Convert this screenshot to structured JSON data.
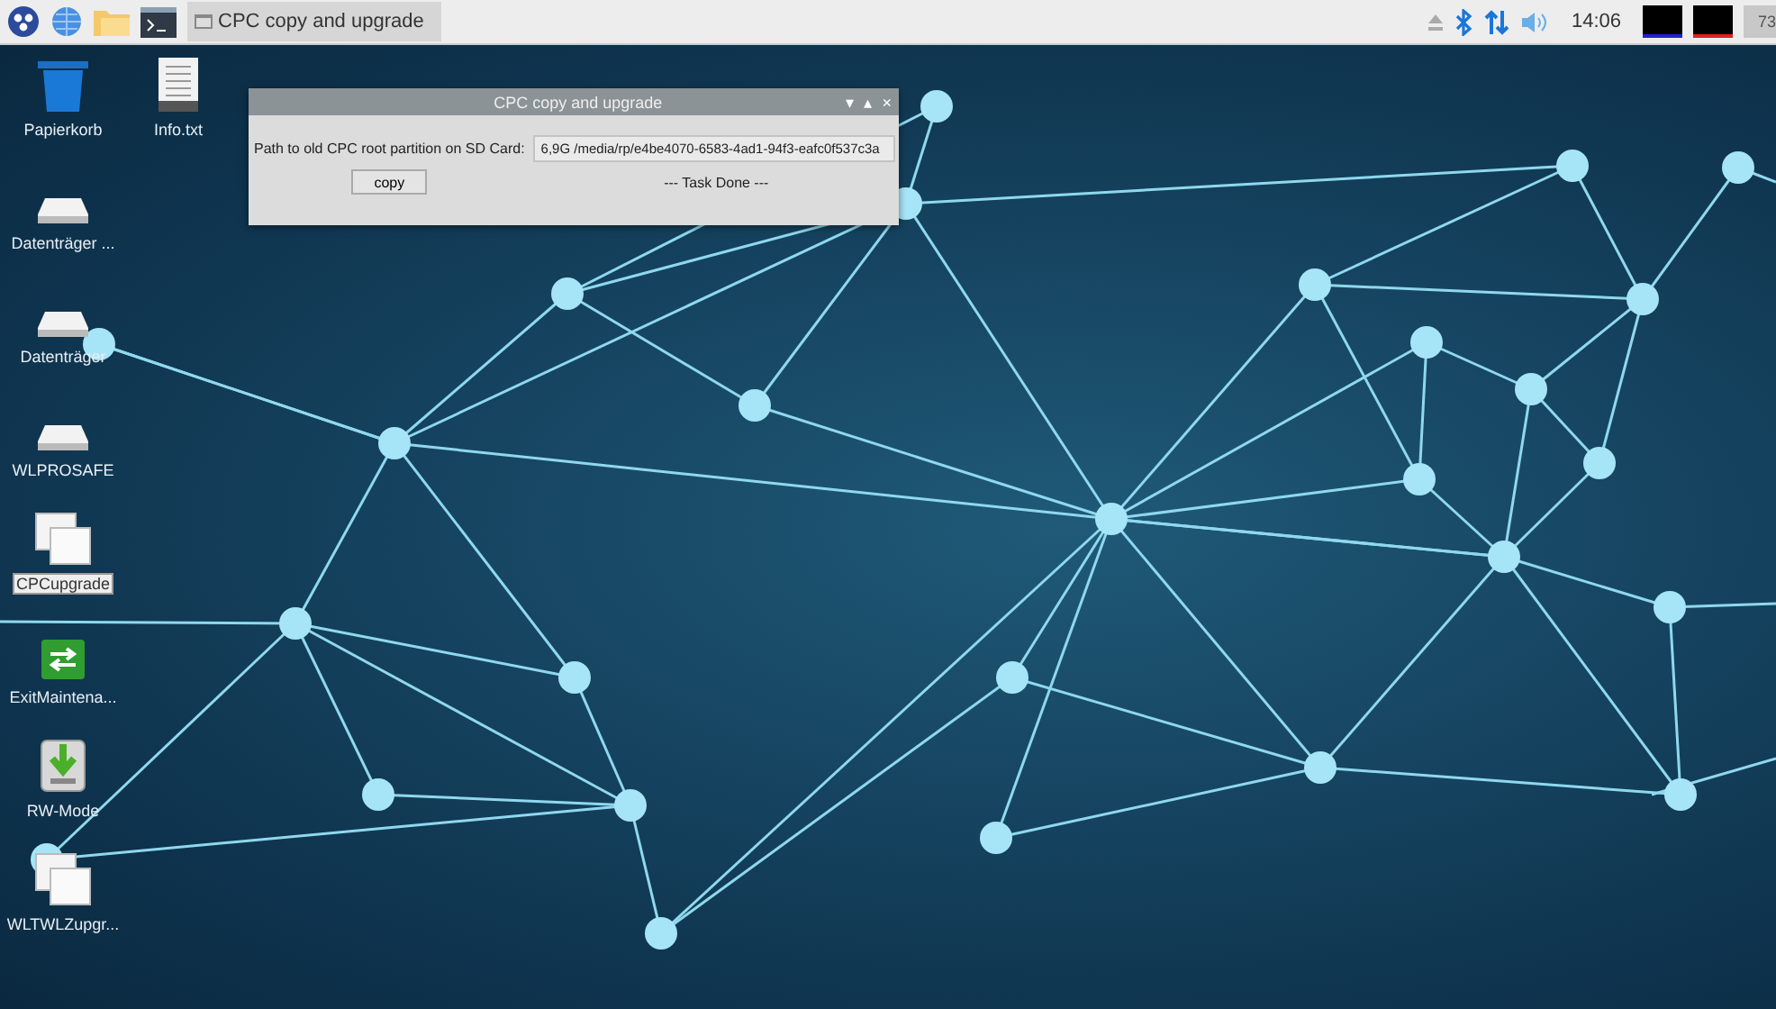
{
  "taskbar": {
    "task_button": {
      "label": "CPC copy and upgrade",
      "selected": true
    },
    "clock": "14:06",
    "cut_label": "73"
  },
  "desktop_icons": [
    {
      "label": "Papierkorb",
      "kind": "trash",
      "selected": false
    },
    {
      "label": "Datenträger ...",
      "kind": "drive",
      "selected": false
    },
    {
      "label": "Datenträger",
      "kind": "drive",
      "selected": false
    },
    {
      "label": "WLPROSAFE",
      "kind": "drive",
      "selected": false
    },
    {
      "label": "CPCupgrade",
      "kind": "window",
      "selected": true
    },
    {
      "label": "ExitMaintena...",
      "kind": "exchange",
      "selected": false
    },
    {
      "label": "RW-Mode",
      "kind": "install",
      "selected": false
    },
    {
      "label": "WLTWLZupgr...",
      "kind": "window",
      "selected": false
    }
  ],
  "second_column_icons": [
    {
      "label": "Info.txt",
      "kind": "textfile",
      "selected": false
    }
  ],
  "dialog": {
    "title": "CPC copy and upgrade",
    "window_buttons": [
      "▾",
      "▴",
      "×"
    ],
    "path_label": "Path to old CPC root partition on SD Card:",
    "path_value": "6,9G /media/rp/e4be4070-6583-4ad1-94f3-eafc0f537c3a",
    "copy_button": "copy",
    "status": "--- Task Done ---"
  }
}
